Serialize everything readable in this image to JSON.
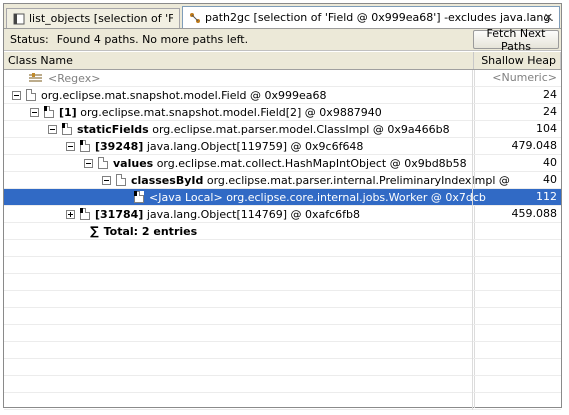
{
  "tabs": [
    {
      "label": "list_objects [selection of 'Field']",
      "icon": "list-objects-icon",
      "active": false
    },
    {
      "label": "path2gc [selection of 'Field @ 0x999ea68'] -excludes java.lang.r...",
      "icon": "path2gc-icon",
      "active": true
    }
  ],
  "status": {
    "label": "Status:",
    "text": "Found 4 paths. No more paths left."
  },
  "toolbar": {
    "next_label": "Fetch Next Paths"
  },
  "columns": {
    "name": "Class Name",
    "heap": "Shallow Heap"
  },
  "filter": {
    "name": "<Regex>",
    "heap": "<Numeric>"
  },
  "rows": [
    {
      "indent": 0,
      "toggle": "minus",
      "icon": "object-icon",
      "bold": "",
      "text": "org.eclipse.mat.snapshot.model.Field @ 0x999ea68",
      "heap": "24"
    },
    {
      "indent": 1,
      "toggle": "minus",
      "icon": "object-icon-dark",
      "bold": "[1]",
      "text": "org.eclipse.mat.snapshot.model.Field[2] @ 0x9887940",
      "heap": "24"
    },
    {
      "indent": 2,
      "toggle": "minus",
      "icon": "object-icon-dark",
      "bold": "staticFields",
      "text": "org.eclipse.mat.parser.model.ClassImpl @ 0x9a466b8",
      "heap": "104"
    },
    {
      "indent": 3,
      "toggle": "minus",
      "icon": "object-icon-dark",
      "bold": "[39248]",
      "text": "java.lang.Object[119759] @ 0x9c6f648",
      "heap": "479.048"
    },
    {
      "indent": 4,
      "toggle": "minus",
      "icon": "object-icon",
      "bold": "values",
      "text": "org.eclipse.mat.collect.HashMapIntObject @ 0x9bd8b58",
      "heap": "40"
    },
    {
      "indent": 5,
      "toggle": "minus",
      "icon": "object-icon",
      "bold": "classesById",
      "text": "org.eclipse.mat.parser.internal.PreliminaryIndexImpl @",
      "heap": "40"
    },
    {
      "indent": 6,
      "toggle": "none",
      "icon": "object-icon-dark",
      "bold": "",
      "local": "<Java Local>",
      "text": "org.eclipse.core.internal.jobs.Worker @ 0x7dcb",
      "heap": "112",
      "selected": true
    },
    {
      "indent": 3,
      "toggle": "plus",
      "icon": "object-icon-dark",
      "bold": "[31784]",
      "text": "java.lang.Object[114769] @ 0xafc6fb8",
      "heap": "459.088"
    }
  ],
  "total": {
    "label": "Total: 2 entries"
  }
}
